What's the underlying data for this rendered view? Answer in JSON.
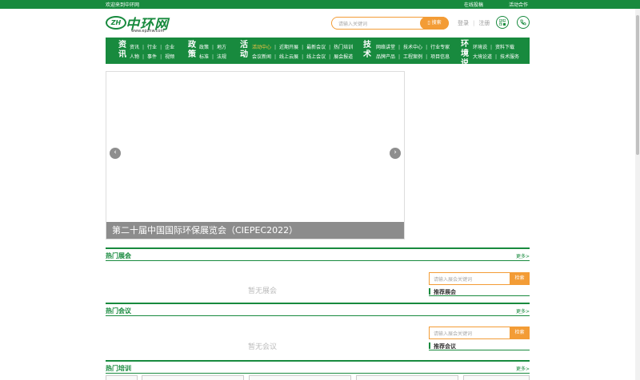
{
  "topbar": {
    "welcome": "欢迎来到中环网",
    "submit": "在线投稿",
    "cooperate": "活动合作"
  },
  "logo": {
    "badge": "ZH",
    "name": "中环网",
    "url": "www.epzhw.com"
  },
  "search": {
    "placeholder": "请输入关键词",
    "button": "搜索"
  },
  "auth": {
    "login": "登录",
    "register": "注册"
  },
  "icons": {
    "qr": "qrcode-icon",
    "phone": "phone-icon"
  },
  "nav": [
    {
      "big": "资讯",
      "row1": [
        "资讯",
        "行业",
        "企业"
      ],
      "row2": [
        "人物",
        "事件",
        "视频"
      ]
    },
    {
      "big": "政策",
      "row1": [
        "政策",
        "地方"
      ],
      "row2": [
        "标准",
        "法规"
      ]
    },
    {
      "big": "活动",
      "row1": [
        "活动中心",
        "近期开展",
        "最新会议",
        "热门培训"
      ],
      "row2": [
        "会议新闻",
        "线上云展",
        "线上会议",
        "展会报道"
      ]
    },
    {
      "big": "技术",
      "row1": [
        "网络讲堂",
        "技术中心",
        "行业专家"
      ],
      "row2": [
        "品牌产品",
        "工程案例",
        "项目信息"
      ]
    },
    {
      "big": "环境说",
      "row1": [
        "环境说",
        "资料下载"
      ],
      "row2": [
        "大境论道",
        "技术服务"
      ]
    }
  ],
  "banner": {
    "caption": "第二十届中国国际环保展览会（CIEPEC2022）",
    "prev": "‹",
    "next": "›"
  },
  "sections": {
    "exhibition": {
      "title": "热门展会",
      "more": "更多>",
      "empty": "暂无展会",
      "search_placeholder": "请输入展会关键词",
      "search_button": "检索",
      "recommend": "推荐展会"
    },
    "meeting": {
      "title": "热门会议",
      "more": "更多>",
      "empty": "暂无会议",
      "search_placeholder": "请输入展会关键词",
      "search_button": "检索",
      "recommend": "推荐会议"
    },
    "training": {
      "title": "热门培训",
      "more": "更多>"
    }
  },
  "colors": {
    "brand": "#188a3e",
    "accent": "#f39c36",
    "highlight": "#f6c343"
  }
}
